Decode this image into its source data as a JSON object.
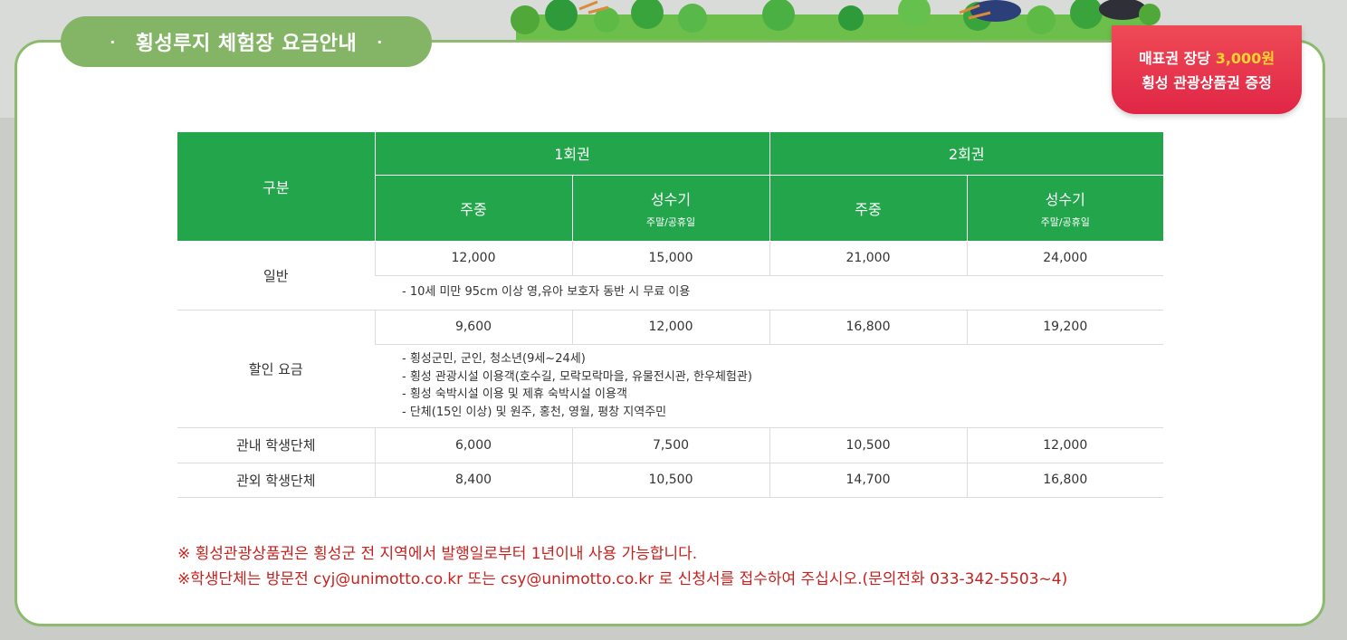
{
  "title": "횡성루지 체험장 요금안내",
  "ticket_notice": {
    "line1_prefix": "매표권 장당 ",
    "line1_amount": "3,000원",
    "line2": "횡성 관광상품권 증정"
  },
  "table": {
    "header_category": "구분",
    "header_groups": [
      "1회권",
      "2회권"
    ],
    "sub_headers": [
      {
        "label": "주중",
        "sub": ""
      },
      {
        "label": "성수기",
        "sub": "주말/공휴일"
      },
      {
        "label": "주중",
        "sub": ""
      },
      {
        "label": "성수기",
        "sub": "주말/공휴일"
      }
    ],
    "rows": [
      {
        "category": "일반",
        "prices": [
          "12,000",
          "15,000",
          "21,000",
          "24,000"
        ],
        "notes": [
          "10세 미만 95cm 이상 영,유아 보호자 동반 시 무료 이용"
        ]
      },
      {
        "category": "할인 요금",
        "prices": [
          "9,600",
          "12,000",
          "16,800",
          "19,200"
        ],
        "notes": [
          "횡성군민, 군인, 청소년(9세~24세)",
          "횡성 관광시설 이용객(호수길, 모락모락마을, 유물전시관, 한우체험관)",
          "횡성 숙박시설 이용 및 제휴 숙박시설 이용객",
          "단체(15인 이상) 및 원주, 홍천, 영월, 평창 지역주민"
        ]
      },
      {
        "category": "관내 학생단체",
        "prices": [
          "6,000",
          "7,500",
          "10,500",
          "12,000"
        ]
      },
      {
        "category": "관외 학생단체",
        "prices": [
          "8,400",
          "10,500",
          "14,700",
          "16,800"
        ]
      }
    ]
  },
  "notices": [
    "※ 횡성관광상품권은 횡성군 전 지역에서 발행일로부터 1년이내 사용 가능합니다.",
    "※학생단체는 방문전 cyj@unimotto.co.kr 또는 csy@unimotto.co.kr 로 신청서를 접수하여 주십시오.(문의전화 033-342-5503~4)"
  ],
  "colors": {
    "header_green": "#23a64b",
    "pill_green": "#84b466",
    "badge_red": "#e02646",
    "notice_red": "#c8211e",
    "amount_yellow": "#ffd22e"
  }
}
